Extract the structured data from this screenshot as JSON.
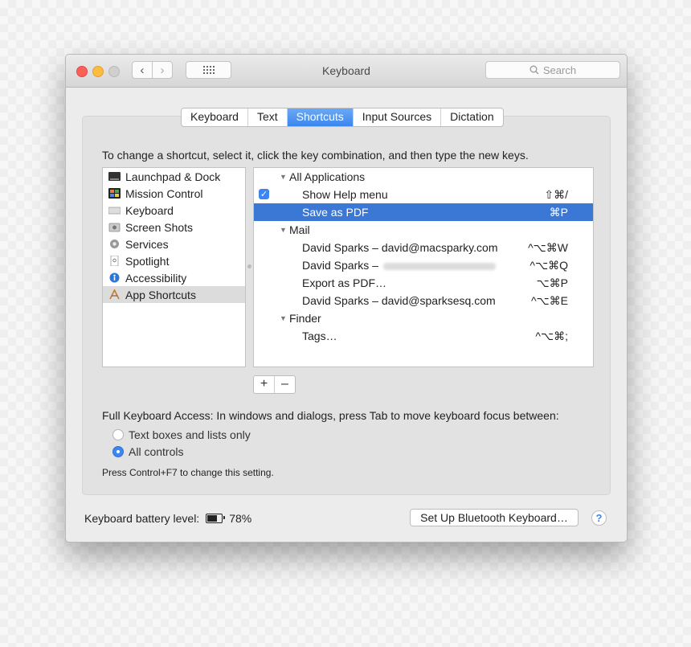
{
  "window": {
    "title": "Keyboard"
  },
  "toolbar": {
    "back_icon": "‹",
    "forward_icon": "›",
    "search_placeholder": "Search"
  },
  "tabs": [
    {
      "label": "Keyboard",
      "active": false
    },
    {
      "label": "Text",
      "active": false
    },
    {
      "label": "Shortcuts",
      "active": true
    },
    {
      "label": "Input Sources",
      "active": false
    },
    {
      "label": "Dictation",
      "active": false
    }
  ],
  "instructions": "To change a shortcut, select it, click the key combination, and then type the new keys.",
  "categories": [
    {
      "label": "Launchpad & Dock",
      "icon": "launchpad-dock-icon"
    },
    {
      "label": "Mission Control",
      "icon": "mission-control-icon"
    },
    {
      "label": "Keyboard",
      "icon": "keyboard-icon"
    },
    {
      "label": "Screen Shots",
      "icon": "screen-shots-icon"
    },
    {
      "label": "Services",
      "icon": "services-gear-icon"
    },
    {
      "label": "Spotlight",
      "icon": "spotlight-icon"
    },
    {
      "label": "Accessibility",
      "icon": "accessibility-icon"
    },
    {
      "label": "App Shortcuts",
      "icon": "app-shortcuts-icon",
      "selected": true
    }
  ],
  "shortcuts": [
    {
      "type": "group",
      "label": "All Applications"
    },
    {
      "type": "item",
      "label": "Show Help menu",
      "keys": "⇧⌘/",
      "checked": true
    },
    {
      "type": "item",
      "label": "Save as PDF",
      "keys": "⌘P",
      "selected": true
    },
    {
      "type": "group",
      "label": "Mail"
    },
    {
      "type": "item",
      "label": "David Sparks – david@macsparky.com",
      "keys": "^⌥⌘W"
    },
    {
      "type": "item",
      "label": "David Sparks –",
      "keys": "^⌥⌘Q",
      "redacted": true
    },
    {
      "type": "item",
      "label": "Export as PDF…",
      "keys": "⌥⌘P"
    },
    {
      "type": "item",
      "label": "David Sparks – david@sparksesq.com",
      "keys": "^⌥⌘E"
    },
    {
      "type": "group",
      "label": "Finder"
    },
    {
      "type": "item",
      "label": "Tags…",
      "keys": "^⌥⌘;"
    }
  ],
  "list_buttons": {
    "add": "+",
    "remove": "–"
  },
  "keyboard_access": {
    "label": "Full Keyboard Access: In windows and dialogs, press Tab to move keyboard focus between:",
    "options": [
      {
        "label": "Text boxes and lists only",
        "selected": false
      },
      {
        "label": "All controls",
        "selected": true
      }
    ],
    "note": "Press Control+F7 to change this setting."
  },
  "battery": {
    "label": "Keyboard battery level:",
    "value": "78%",
    "level": 0.78
  },
  "bluetooth_button": "Set Up Bluetooth Keyboard…",
  "help_button": "?"
}
